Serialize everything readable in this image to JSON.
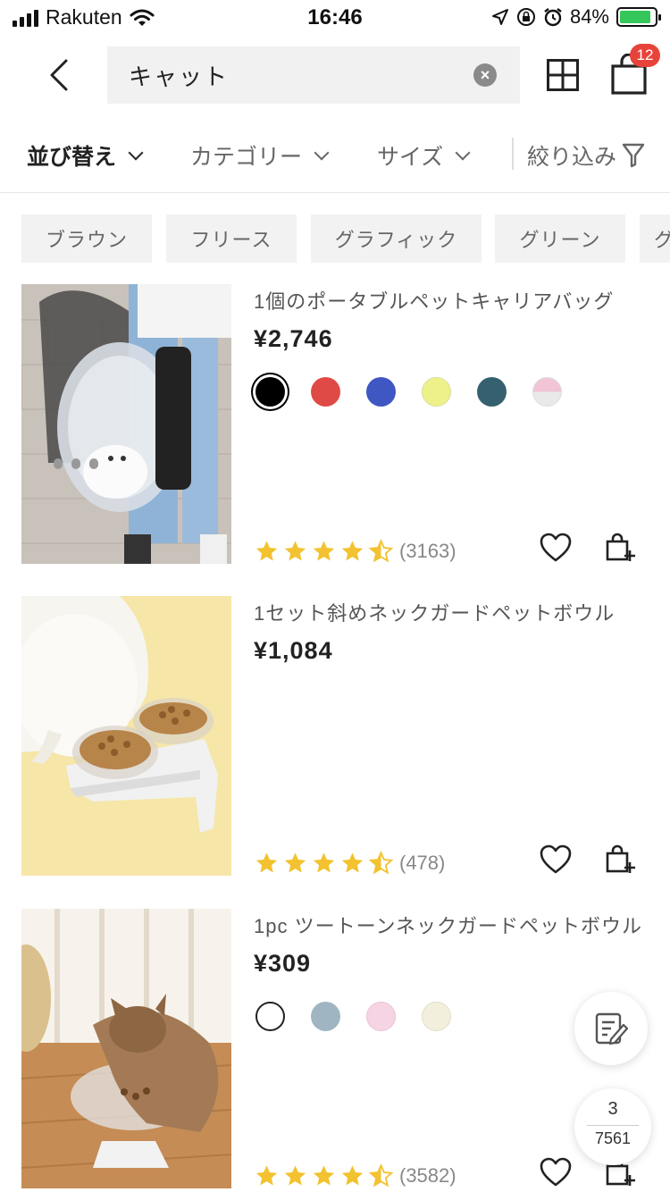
{
  "status_bar": {
    "carrier": "Rakuten",
    "time": "16:46",
    "battery": "84%"
  },
  "header": {
    "search_value": "キャット",
    "cart_count": "12"
  },
  "filters": [
    {
      "label": "並び替え",
      "active": true
    },
    {
      "label": "カテゴリー",
      "active": false
    },
    {
      "label": "サイズ",
      "active": false
    },
    {
      "label": "絞り込み",
      "active": false
    }
  ],
  "chips": [
    "ブラウン",
    "フリース",
    "グラフィック",
    "グリーン",
    "グ"
  ],
  "products": [
    {
      "title": "1個のポータブルペットキャリアバッグ",
      "price": "¥2,746",
      "rating": 4.5,
      "review_count": "(3163)",
      "swatches": [
        "#000000",
        "#e04a46",
        "#3f57c2",
        "#eef18a",
        "#35606f",
        "pink-gray"
      ]
    },
    {
      "title": "1セット斜めネックガードペットボウル",
      "price": "¥1,084",
      "rating": 4.5,
      "review_count": "(478)",
      "swatches": []
    },
    {
      "title": "1pc ツートーンネックガードペットボウル",
      "price": "¥309",
      "rating": 4.5,
      "review_count": "(3582)",
      "swatches": [
        "#ffffff",
        "#9fb6c2",
        "#f6d4e4",
        "#f2efdd"
      ]
    }
  ],
  "pagination": {
    "current": "3",
    "total": "7561"
  },
  "colors": {
    "star": "#f2c230",
    "badge": "#e8433b",
    "battery": "#35c759"
  }
}
